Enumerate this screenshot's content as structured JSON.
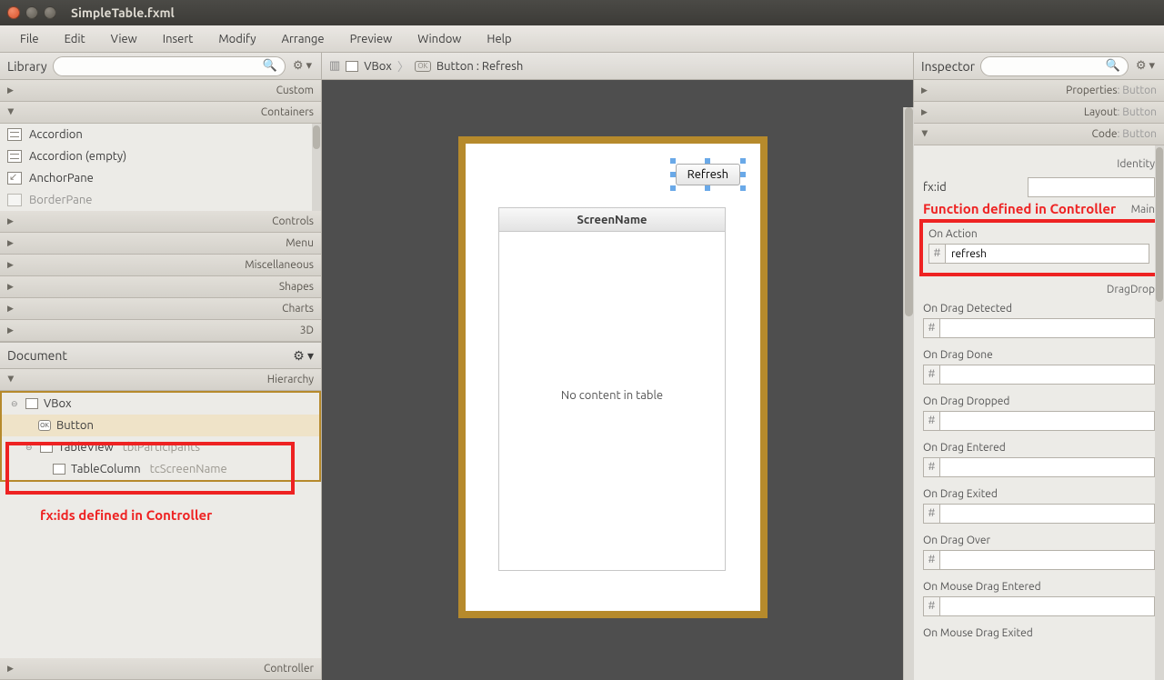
{
  "window": {
    "title": "SimpleTable.fxml"
  },
  "menubar": [
    "File",
    "Edit",
    "View",
    "Insert",
    "Modify",
    "Arrange",
    "Preview",
    "Window",
    "Help"
  ],
  "library": {
    "title": "Library",
    "sections": [
      "Custom",
      "Containers",
      "Controls",
      "Menu",
      "Miscellaneous",
      "Shapes",
      "Charts",
      "3D"
    ],
    "open_section": "Containers",
    "items": [
      "Accordion",
      "Accordion  (empty)",
      "AnchorPane",
      "BorderPane"
    ]
  },
  "document": {
    "title": "Document",
    "section": "Hierarchy",
    "footer": "Controller",
    "tree": {
      "root": "VBox",
      "nodes": [
        {
          "label": "Button",
          "id": "",
          "depth": 1,
          "selected": true
        },
        {
          "label": "TableView",
          "id": "tblParticipants",
          "depth": 1
        },
        {
          "label": "TableColumn",
          "id": "tcScreenName",
          "depth": 2
        }
      ]
    },
    "annotation": "fx:ids defined in Controller"
  },
  "breadcrumb": {
    "selector_icon": "▥",
    "items": [
      "VBox",
      "Button : Refresh"
    ]
  },
  "canvas": {
    "button_label": "Refresh",
    "table_header": "ScreenName",
    "empty_text": "No content in table"
  },
  "inspector": {
    "title": "Inspector",
    "tabs": [
      {
        "name": "Properties",
        "suffix": ": Button"
      },
      {
        "name": "Layout",
        "suffix": ": Button"
      },
      {
        "name": "Code",
        "suffix": ": Button"
      }
    ],
    "open_tab": 2,
    "identity_label": "Identity",
    "fxid_label": "fx:id",
    "fxid_value": "",
    "annotation": "Function defined in Controller",
    "main_label": "Main",
    "on_action_label": "On Action",
    "on_action_value": "refresh",
    "dragdrop_label": "DragDrop",
    "drag_fields": [
      "On Drag Detected",
      "On Drag Done",
      "On Drag Dropped",
      "On Drag Entered",
      "On Drag Exited",
      "On Drag Over",
      "On Mouse Drag Entered",
      "On Mouse Drag Exited"
    ]
  }
}
